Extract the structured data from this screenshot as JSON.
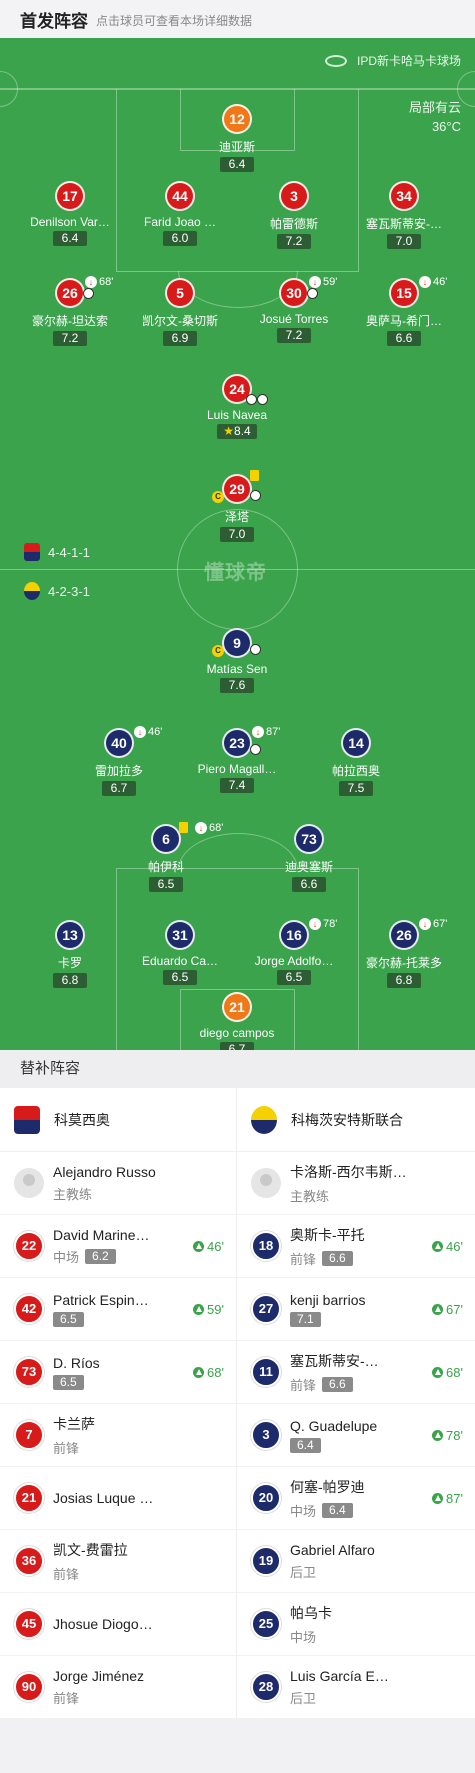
{
  "header": {
    "title": "首发阵容",
    "subtitle": "点击球员可查看本场详细数据"
  },
  "pitch": {
    "venue": "IPD新卡哈马卡球场",
    "weather": "局部有云",
    "temperature": "36°C",
    "watermark": "懂球帝",
    "home_formation": "4-4-1-1",
    "away_formation": "4-2-3-1",
    "home_color": "#d71a1a",
    "away_color": "#1d2b6b",
    "keeper_color": "#f07818"
  },
  "home_players": [
    {
      "num": "12",
      "name": "迪亚斯",
      "rating": "6.4",
      "kit": "gk"
    },
    {
      "num": "17",
      "name": "Denilson Var…",
      "rating": "6.4",
      "kit": "red"
    },
    {
      "num": "44",
      "name": "Farid Joao …",
      "rating": "6.0",
      "kit": "red"
    },
    {
      "num": "3",
      "name": "帕雷德斯",
      "rating": "7.2",
      "kit": "red"
    },
    {
      "num": "34",
      "name": "塞瓦斯蒂安-…",
      "rating": "7.0",
      "kit": "red"
    },
    {
      "num": "26",
      "name": "豪尔赫-坦达索",
      "rating": "7.2",
      "kit": "red",
      "sub_out": "68'"
    },
    {
      "num": "5",
      "name": "凯尔文-桑切斯",
      "rating": "6.9",
      "kit": "red"
    },
    {
      "num": "30",
      "name": "Josué Torres",
      "rating": "7.2",
      "kit": "red",
      "sub_out": "59'"
    },
    {
      "num": "15",
      "name": "奥萨马-希门…",
      "rating": "6.6",
      "kit": "red",
      "sub_out": "46'"
    },
    {
      "num": "24",
      "name": "Luis Navea",
      "rating": "8.4",
      "kit": "red"
    },
    {
      "num": "29",
      "name": "泽塔",
      "rating": "7.0",
      "kit": "red"
    }
  ],
  "away_players": [
    {
      "num": "9",
      "name": "Matías Sen",
      "rating": "7.6",
      "kit": "blue"
    },
    {
      "num": "40",
      "name": "雷加拉多",
      "rating": "6.7",
      "kit": "blue",
      "sub_out": "46'"
    },
    {
      "num": "23",
      "name": "Piero Magall…",
      "rating": "7.4",
      "kit": "blue",
      "sub_out": "87'"
    },
    {
      "num": "14",
      "name": "帕拉西奥",
      "rating": "7.5",
      "kit": "blue"
    },
    {
      "num": "6",
      "name": "帕伊科",
      "rating": "6.5",
      "kit": "blue",
      "sub_out": "68'"
    },
    {
      "num": "73",
      "name": "迪奥塞斯",
      "rating": "6.6",
      "kit": "blue"
    },
    {
      "num": "13",
      "name": "卡罗",
      "rating": "6.8",
      "kit": "blue"
    },
    {
      "num": "31",
      "name": "Eduardo Ca…",
      "rating": "6.5",
      "kit": "blue"
    },
    {
      "num": "16",
      "name": "Jorge Adolfo…",
      "rating": "6.5",
      "kit": "blue",
      "sub_out": "78'"
    },
    {
      "num": "26",
      "name": "豪尔赫-托莱多",
      "rating": "6.8",
      "kit": "blue",
      "sub_out": "67'"
    },
    {
      "num": "21",
      "name": "diego campos",
      "rating": "6.7",
      "kit": "gk"
    }
  ],
  "subs": {
    "title": "替补阵容",
    "home": {
      "team": "科莫西奥",
      "coach": {
        "name": "Alejandro Russo",
        "role": "主教练"
      },
      "players": [
        {
          "num": "22",
          "name": "David Marine…",
          "pos": "中场",
          "rating": "6.2",
          "in": "46'"
        },
        {
          "num": "42",
          "name": "Patrick Espin…",
          "pos": "",
          "rating": "6.5",
          "in": "59'"
        },
        {
          "num": "73",
          "name": "D. Ríos",
          "pos": "",
          "rating": "6.5",
          "in": "68'"
        },
        {
          "num": "7",
          "name": "卡兰萨",
          "pos": "前锋",
          "rating": "",
          "in": ""
        },
        {
          "num": "21",
          "name": "Josias Luque …",
          "pos": "",
          "rating": "",
          "in": ""
        },
        {
          "num": "36",
          "name": "凯文-费雷拉",
          "pos": "前锋",
          "rating": "",
          "in": ""
        },
        {
          "num": "45",
          "name": "Jhosue Diogo…",
          "pos": "",
          "rating": "",
          "in": ""
        },
        {
          "num": "90",
          "name": "Jorge Jiménez",
          "pos": "前锋",
          "rating": "",
          "in": ""
        }
      ]
    },
    "away": {
      "team": "科梅茨安特斯联合",
      "coach": {
        "name": "卡洛斯-西尔韦斯特里",
        "role": "主教练"
      },
      "players": [
        {
          "num": "18",
          "name": "奥斯卡-平托",
          "pos": "前锋",
          "rating": "6.6",
          "in": "46'"
        },
        {
          "num": "27",
          "name": "kenji barrios",
          "pos": "",
          "rating": "7.1",
          "in": "67'"
        },
        {
          "num": "11",
          "name": "塞瓦斯蒂安-…",
          "pos": "前锋",
          "rating": "6.6",
          "in": "68'"
        },
        {
          "num": "3",
          "name": "Q. Guadelupe",
          "pos": "",
          "rating": "6.4",
          "in": "78'"
        },
        {
          "num": "20",
          "name": "何塞-帕罗迪",
          "pos": "中场",
          "rating": "6.4",
          "in": "87'"
        },
        {
          "num": "19",
          "name": "Gabriel Alfaro",
          "pos": "后卫",
          "rating": "",
          "in": ""
        },
        {
          "num": "25",
          "name": "帕乌卡",
          "pos": "中场",
          "rating": "",
          "in": ""
        },
        {
          "num": "28",
          "name": "Luis García E…",
          "pos": "后卫",
          "rating": "",
          "in": ""
        }
      ]
    }
  }
}
